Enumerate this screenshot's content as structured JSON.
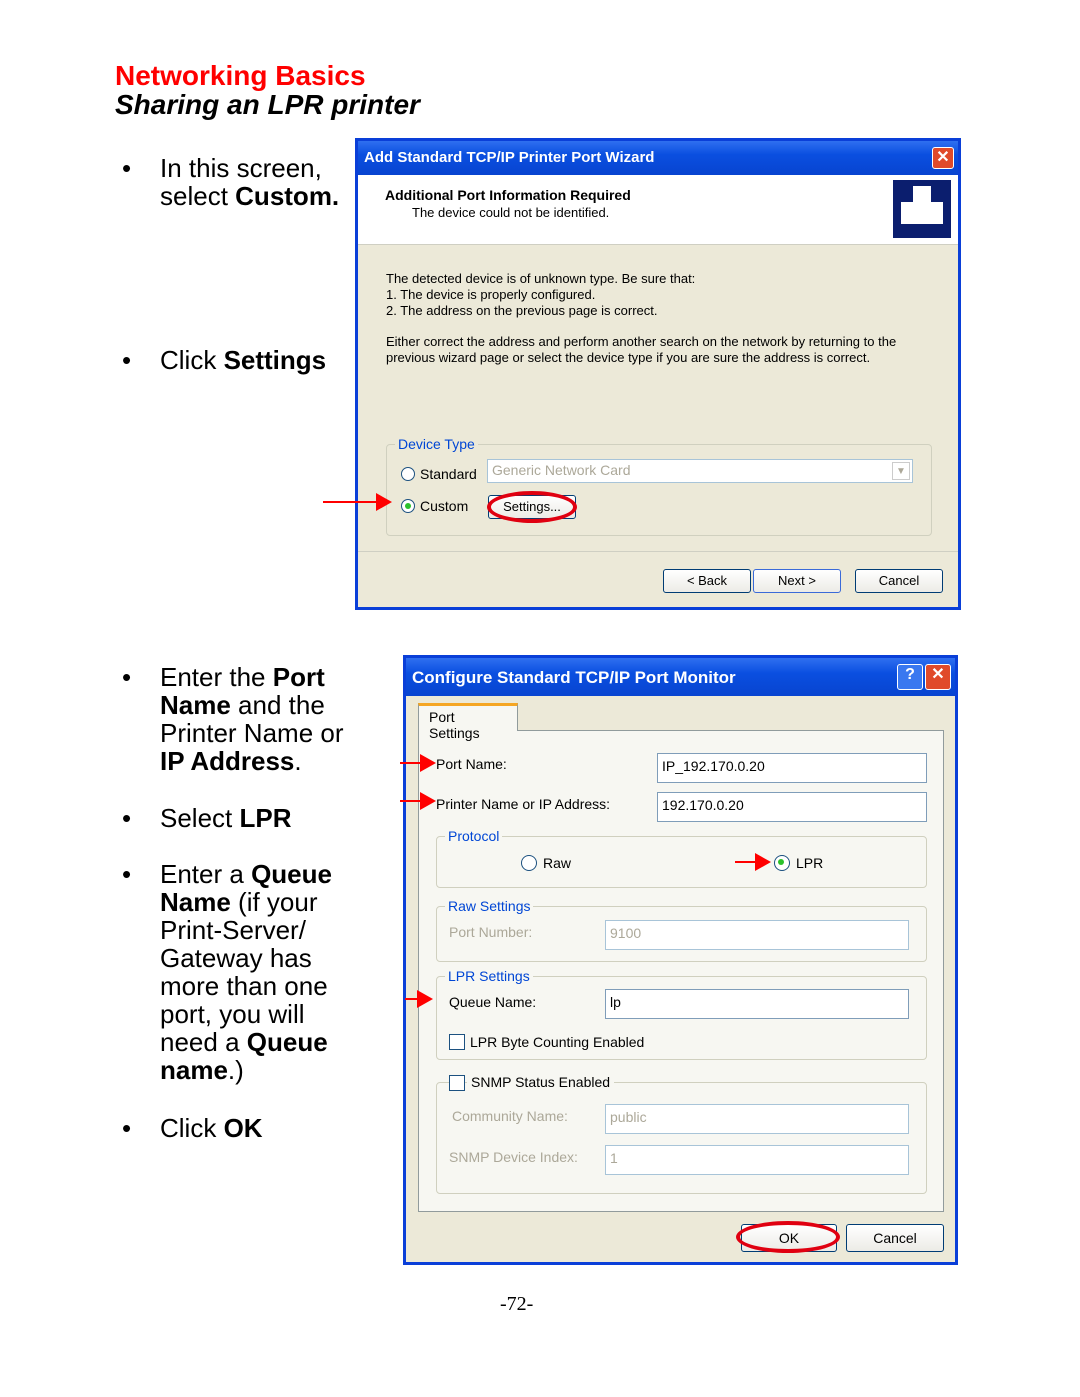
{
  "header": {
    "section": "Networking Basics",
    "title": "Sharing an LPR printer"
  },
  "instructions": [
    {
      "parts": [
        [
          "In this screen, select ",
          ""
        ],
        [
          "Custom.",
          "b"
        ]
      ]
    },
    {
      "parts": [
        [
          "Click ",
          ""
        ],
        [
          "Settings",
          "b"
        ]
      ]
    },
    {
      "parts": [
        [
          "Enter the ",
          ""
        ],
        [
          "Port Name",
          "b"
        ],
        [
          " and the ",
          ""
        ],
        [
          "Printer Name",
          ""
        ],
        [
          " or ",
          ""
        ],
        [
          "IP Address",
          "b"
        ],
        [
          ".",
          ""
        ]
      ]
    },
    {
      "parts": [
        [
          "Select ",
          ""
        ],
        [
          "LPR",
          "b"
        ]
      ]
    },
    {
      "parts": [
        [
          "Enter a ",
          ""
        ],
        [
          "Queue Name",
          "b"
        ],
        [
          " (if your Print-Server/ Gateway has more than one port, you will need a ",
          ""
        ],
        [
          "Queue name",
          "b"
        ],
        [
          ".)",
          ""
        ]
      ]
    },
    {
      "parts": [
        [
          "Click ",
          ""
        ],
        [
          "OK",
          "b"
        ]
      ]
    }
  ],
  "wizard": {
    "title": "Add Standard TCP/IP Printer Port Wizard",
    "heading": "Additional Port Information Required",
    "subheading": "The device could not be identified.",
    "body_lines": [
      "The detected device is of unknown type.  Be sure that:",
      "1. The device is properly configured.",
      "2.  The address on the previous page is correct."
    ],
    "body_para": [
      "Either correct the address and perform another search on the network by returning to the",
      "previous wizard page or select the device type if you are sure the address is correct."
    ],
    "device_type_label": "Device Type",
    "standard_label": "Standard",
    "standard_value": "Generic Network Card",
    "custom_label": "Custom",
    "custom_selected": true,
    "settings_button": "Settings...",
    "back_button": "< Back",
    "next_button": "Next >",
    "cancel_button": "Cancel"
  },
  "monitor": {
    "title": "Configure Standard TCP/IP Port Monitor",
    "tab": "Port Settings",
    "port_name_label": "Port Name:",
    "port_name_value": "IP_192.170.0.20",
    "printer_label": "Printer Name or IP Address:",
    "printer_value": "192.170.0.20",
    "protocol_label": "Protocol",
    "raw_label": "Raw",
    "lpr_label": "LPR",
    "selected_protocol": "LPR",
    "raw_settings_label": "Raw Settings",
    "port_number_label": "Port Number:",
    "port_number_value": "9100",
    "lpr_settings_label": "LPR Settings",
    "queue_label": "Queue Name:",
    "queue_value": "lp",
    "byte_counting_label": "LPR Byte Counting Enabled",
    "byte_counting": false,
    "snmp_label": "SNMP Status Enabled",
    "snmp": false,
    "community_label": "Community Name:",
    "community_value": "public",
    "device_index_label": "SNMP Device Index:",
    "device_index_value": "1",
    "ok_button": "OK",
    "cancel_button": "Cancel"
  },
  "page_number": "-72-",
  "colors": {
    "heading": "#ff0000",
    "titlebar": "#0a4fe0",
    "dialog_bg": "#ECE9D8",
    "highlight": "#e00010"
  }
}
